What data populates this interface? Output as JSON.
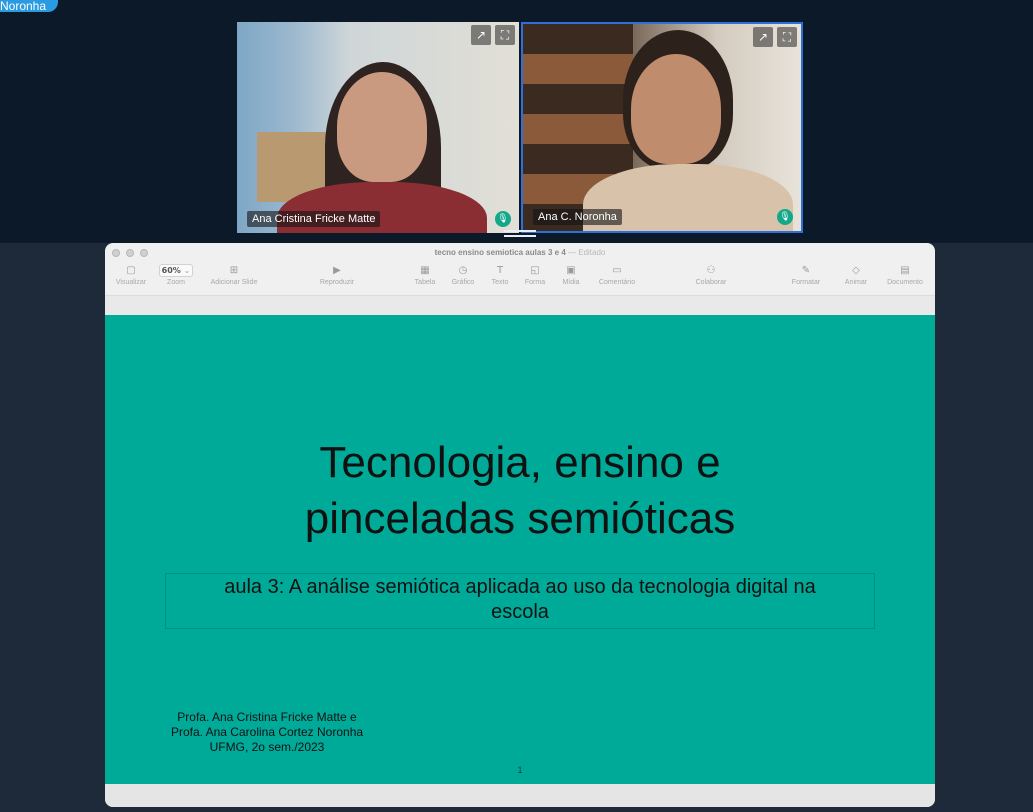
{
  "meeting": {
    "speaker_pill": "Noronha",
    "participants": [
      {
        "name": "Ana Cristina Fricke Matte",
        "tools": [
          "↗",
          "⛶"
        ]
      },
      {
        "name": "Ana C. Noronha",
        "tools": [
          "↗",
          "⛶"
        ]
      }
    ],
    "mic_glyph": "🎙",
    "active_speaker_color": "#2f6fd6",
    "mic_color": "#13a889"
  },
  "keynote": {
    "doc_title": "tecno ensino semiotica aulas 3 e 4",
    "doc_status": "— Editado",
    "toolbar": {
      "visualizar": {
        "icon": "▢",
        "label": "Visualizar"
      },
      "zoom": {
        "value": "60%",
        "chevron": "⌄",
        "label": "Zoom"
      },
      "adicionar_slide": {
        "icon": "⊞",
        "label": "Adicionar Slide"
      },
      "reproduzir": {
        "icon": "▶",
        "label": "Reproduzir"
      },
      "tabela": {
        "icon": "▦",
        "label": "Tabela"
      },
      "grafico": {
        "icon": "◷",
        "label": "Gráfico"
      },
      "texto": {
        "icon": "T",
        "label": "Texto"
      },
      "forma": {
        "icon": "◱",
        "label": "Forma"
      },
      "midia": {
        "icon": "▣",
        "label": "Mídia"
      },
      "comentario": {
        "icon": "▭",
        "label": "Comentário"
      },
      "colaborar": {
        "icon": "⚇",
        "label": "Colaborar"
      },
      "formatar": {
        "icon": "✎",
        "label": "Formatar"
      },
      "animar": {
        "icon": "◇",
        "label": "Animar"
      },
      "documento": {
        "icon": "▤",
        "label": "Documento"
      }
    }
  },
  "slide": {
    "background_color": "#00aa99",
    "title_line1": "Tecnologia, ensino e",
    "title_line2": "pinceladas semióticas",
    "subtitle_line1": "aula 3: A análise semiótica aplicada ao uso da tecnologia digital na",
    "subtitle_line2": "escola",
    "author_line1": "Profa. Ana Cristina Fricke Matte e",
    "author_line2": "Profa. Ana Carolina Cortez Noronha",
    "author_line3": "UFMG, 2o sem./2023",
    "number": "1"
  }
}
